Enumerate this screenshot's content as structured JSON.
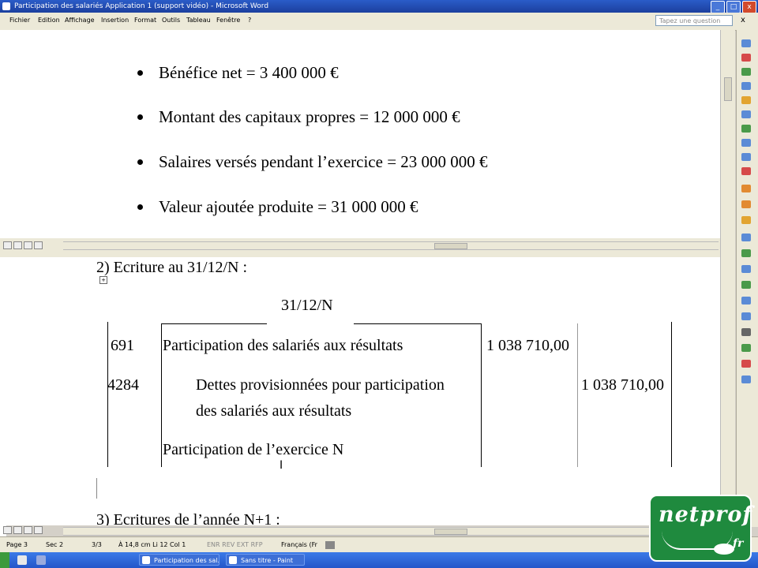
{
  "window": {
    "title": "Participation des salariés Application 1 (support vidéo) - Microsoft Word",
    "minimize": "_",
    "maximize": "□",
    "close": "x"
  },
  "menu": {
    "items": [
      "Fichier",
      "Edition",
      "Affichage",
      "Insertion",
      "Format",
      "Outils",
      "Tableau",
      "Fenêtre",
      "?"
    ],
    "help_placeholder": "Tapez une question",
    "close_doc": "x"
  },
  "doc_top": {
    "bullets": [
      "Bénéfice net =  3 400 000 €",
      "Montant des capitaux propres = 12 000 000 €",
      "Salaires versés pendant l’exercice = 23 000 000 €",
      "Valeur ajoutée produite = 31 000 000 €"
    ]
  },
  "doc_bottom": {
    "section2_title": "2)  Ecriture au 31/12/N :",
    "date": "31/12/N",
    "entries": [
      {
        "account": "691",
        "label": "Participation des salariés aux résultats",
        "debit": "1 038 710,00",
        "credit": ""
      },
      {
        "account": "4284",
        "label": "Dettes provisionnées pour participation",
        "label2": "des salariés aux résultats",
        "debit": "",
        "credit": "1 038 710,00"
      }
    ],
    "narration": "Participation de l’exercice N",
    "section3_title": "3)  Ecritures de l’année N+1 :"
  },
  "status": {
    "page": "Page 3",
    "section": "Sec 2",
    "pages": "3/3",
    "position": "À 14,8 cm  Li 12   Col 1",
    "modes": "ENR  REV  EXT  RFP",
    "language": "Français (Fr"
  },
  "taskbar": {
    "tasks": [
      "Participation des sal...",
      "Sans titre - Paint"
    ]
  },
  "logo": {
    "word": "netprof",
    "suffix": "fr"
  },
  "colors": {
    "title_bar": "#1c3f9e",
    "chrome": "#ece9d8",
    "logo_green": "#1f8a3e"
  }
}
